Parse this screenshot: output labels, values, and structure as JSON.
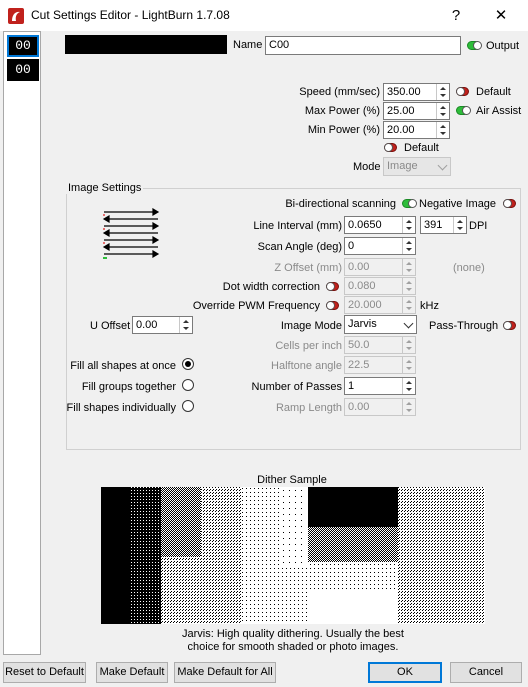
{
  "window": {
    "title": "Cut Settings Editor - LightBurn 1.7.08",
    "help_glyph": "?",
    "close_glyph": "✕",
    "app_icon": "lightburn-logo-icon"
  },
  "layers": [
    {
      "label": "00",
      "selected": true
    },
    {
      "label": "00",
      "selected": false
    }
  ],
  "header": {
    "layer_color": "#000000",
    "name_label": "Name",
    "name_value": "C00",
    "output_label": "Output",
    "output_on": true
  },
  "power": {
    "speed_label": "Speed (mm/sec)",
    "speed_value": "350.00",
    "speed_default_label": "Default",
    "max_power_label": "Max Power (%)",
    "max_power_value": "25.00",
    "air_assist_label": "Air Assist",
    "min_power_label": "Min Power (%)",
    "min_power_value": "20.00",
    "power_default_label": "Default",
    "mode_label": "Mode",
    "mode_value": "Image"
  },
  "image_settings": {
    "group_title": "Image Settings",
    "bidirectional_label": "Bi-directional scanning",
    "bidirectional_on": true,
    "negative_label": "Negative Image",
    "negative_on": false,
    "line_interval_label": "Line Interval (mm)",
    "line_interval_value": "0.0650",
    "dpi_value": "391",
    "dpi_label": "DPI",
    "scan_angle_label": "Scan Angle (deg)",
    "scan_angle_value": "0",
    "z_offset_label": "Z Offset (mm)",
    "z_offset_value": "0.00",
    "z_offset_note": "(none)",
    "dot_width_label": "Dot width correction",
    "dot_width_value": "0.080",
    "pwm_label": "Override PWM Frequency",
    "pwm_value": "20.000",
    "pwm_unit": "kHz",
    "u_offset_label": "U Offset",
    "u_offset_value": "0.00",
    "image_mode_label": "Image Mode",
    "image_mode_value": "Jarvis",
    "pass_through_label": "Pass-Through",
    "cells_label": "Cells per inch",
    "cells_value": "50.0",
    "halftone_label": "Halftone angle",
    "halftone_value": "22.5",
    "passes_label": "Number of Passes",
    "passes_value": "1",
    "ramp_label": "Ramp Length",
    "ramp_value": "0.00",
    "fill_options": [
      {
        "label": "Fill all shapes at once",
        "checked": true
      },
      {
        "label": "Fill groups together",
        "checked": false
      },
      {
        "label": "Fill shapes individually",
        "checked": false
      }
    ]
  },
  "dither": {
    "title": "Dither Sample",
    "caption_line1": "Jarvis: High quality dithering. Usually the best",
    "caption_line2": "choice for smooth shaded or photo images."
  },
  "footer": {
    "reset_label": "Reset to Default",
    "make_default_label": "Make Default",
    "make_default_all_label": "Make Default for All",
    "ok_label": "OK",
    "cancel_label": "Cancel"
  }
}
